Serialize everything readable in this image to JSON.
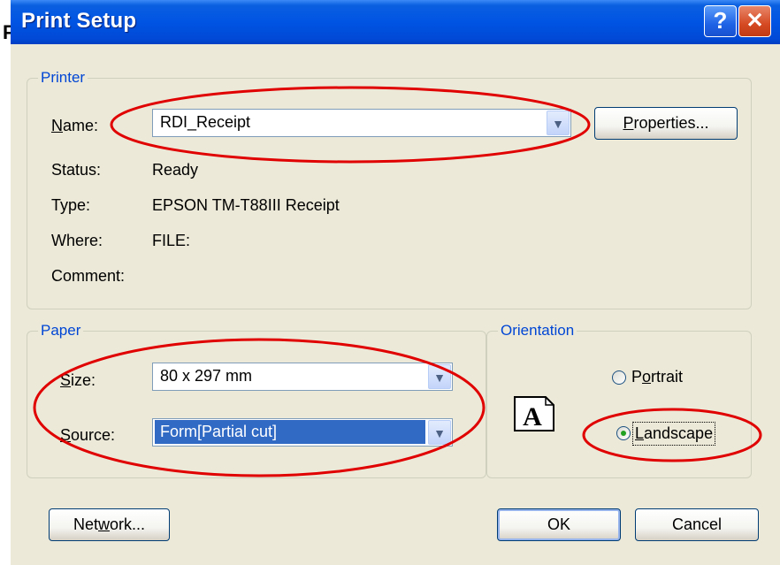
{
  "window": {
    "title": "Print Setup",
    "edge_char": "F",
    "help_label": "?",
    "close_label": "✕"
  },
  "printer": {
    "legend": "Printer",
    "name_label": "Name:",
    "name_value": "RDI_Receipt",
    "properties_label": "Properties...",
    "status_label": "Status:",
    "status_value": "Ready",
    "type_label": "Type:",
    "type_value": "EPSON TM-T88III Receipt",
    "where_label": "Where:",
    "where_value": "FILE:",
    "comment_label": "Comment:",
    "comment_value": ""
  },
  "paper": {
    "legend": "Paper",
    "size_label": "Size:",
    "size_value": "80 x 297 mm",
    "source_label": "Source:",
    "source_value": "Form[Partial cut]"
  },
  "orientation": {
    "legend": "Orientation",
    "portrait_label": "Portrait",
    "landscape_label": "Landscape",
    "selected": "Landscape",
    "preview_letter": "A"
  },
  "buttons": {
    "network_label": "Network...",
    "ok_label": "OK",
    "cancel_label": "Cancel"
  },
  "colors": {
    "annotation": "#e00000",
    "title_bar": "#0054e3",
    "dialog_bg": "#ece9d8",
    "group_legend": "#0046d5"
  }
}
